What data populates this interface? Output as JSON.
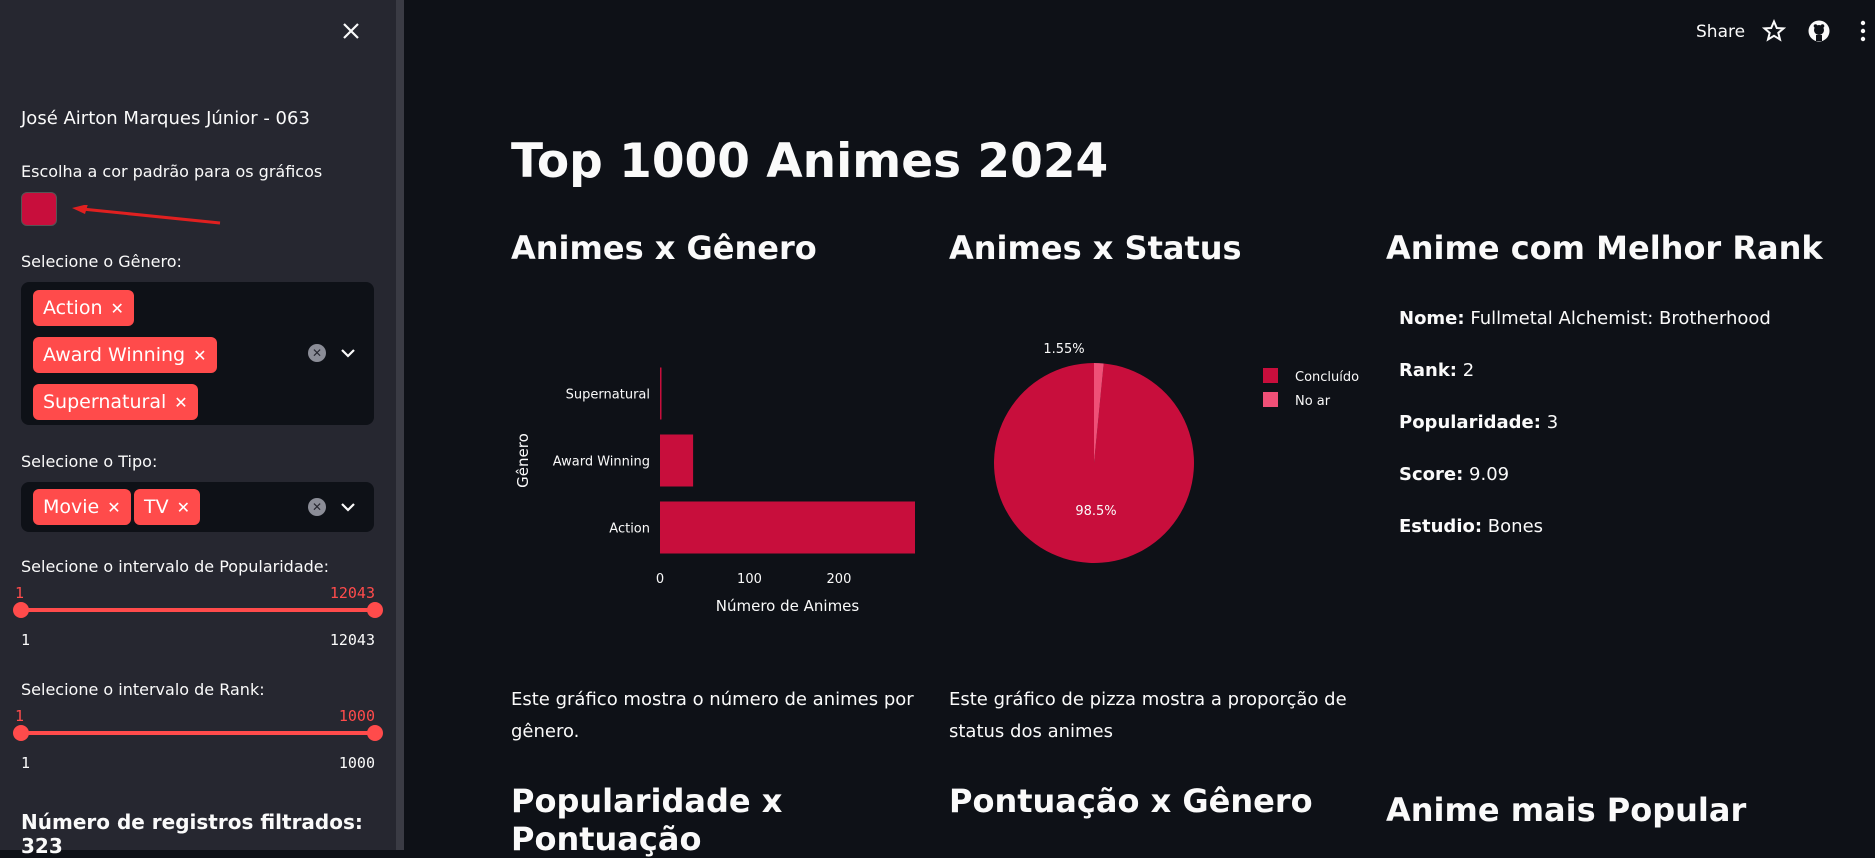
{
  "sidebar": {
    "author": "José Airton Marques Júnior - 063",
    "color_label": "Escolha a cor padrão para os gráficos",
    "color_value": "#c80e3c",
    "genre_label": "Selecione o Gênero:",
    "genres": [
      "Action",
      "Award Winning",
      "Supernatural"
    ],
    "type_label": "Selecione o Tipo:",
    "types": [
      "Movie",
      "TV"
    ],
    "popularity_label": "Selecione o intervalo de Popularidade:",
    "popularity": {
      "min": "1",
      "max": "12043",
      "bound_min": "1",
      "bound_max": "12043"
    },
    "rank_label": "Selecione o intervalo de Rank:",
    "rank": {
      "min": "1",
      "max": "1000",
      "bound_min": "1",
      "bound_max": "1000"
    },
    "records": "Número de registros filtrados: 323",
    "icons": {
      "close": "close-icon",
      "clear": "clear-icon",
      "dropdown": "chevron-down-icon"
    }
  },
  "toolbar": {
    "share": "Share",
    "icons": [
      "star-icon",
      "github-icon",
      "kebab-menu-icon"
    ]
  },
  "main": {
    "title": "Top 1000 Animes 2024",
    "col1_title": "Animes x Gênero",
    "col1_caption": "Este gráfico mostra o número de animes por gênero.",
    "col2_title": "Animes x Status",
    "col2_caption": "Este gráfico de pizza mostra a proporção de status dos animes",
    "col3_title": "Anime com Melhor Rank",
    "best": {
      "name_label": "Nome:",
      "name": "Fullmetal Alchemist: Brotherhood",
      "rank_label": "Rank:",
      "rank": "2",
      "pop_label": "Popularidade:",
      "pop": "3",
      "score_label": "Score:",
      "score": "9.09",
      "studio_label": "Estudio:",
      "studio": "Bones"
    },
    "row2_col1_title": "Popularidade x Pontuação",
    "row2_col2_title": "Pontuação x Gênero",
    "row2_col3_title": "Anime mais Popular"
  },
  "chart_data": [
    {
      "type": "bar",
      "orientation": "horizontal",
      "categories": [
        "Action",
        "Award Winning",
        "Supernatural"
      ],
      "values": [
        285,
        37,
        1
      ],
      "xlabel": "Número de Animes",
      "ylabel": "Gênero",
      "xticks": [
        0,
        100,
        200
      ],
      "xlim": [
        0,
        285
      ],
      "color": "#c80e3c"
    },
    {
      "type": "pie",
      "labels": [
        "Concluído",
        "No ar"
      ],
      "values": [
        98.5,
        1.55
      ],
      "value_labels": [
        "98.5%",
        "1.55%"
      ],
      "colors": [
        "#c80e3c",
        "#ef5077"
      ],
      "legend": "right"
    }
  ]
}
